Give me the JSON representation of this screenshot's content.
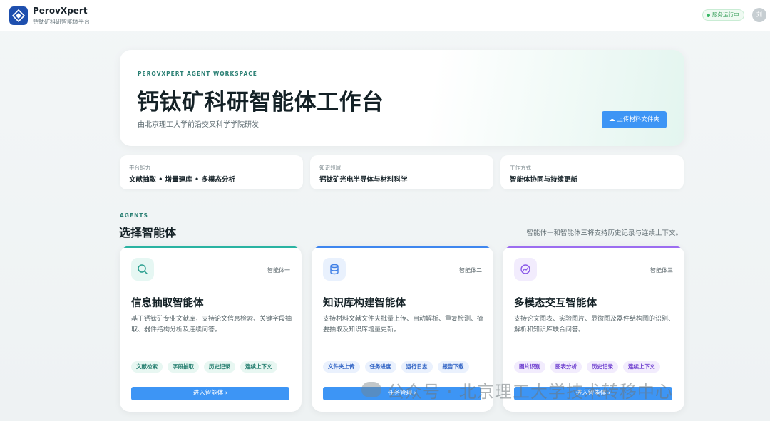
{
  "header": {
    "brand_name": "PerovXpert",
    "brand_sub": "钙钛矿科研智能体平台",
    "status": "服务运行中",
    "avatar_initial": "刘"
  },
  "hero": {
    "eyebrow": "PEROVXPERT AGENT WORKSPACE",
    "title": "钙钛矿科研智能体工作台",
    "subtitle": "由北京理工大学前沿交叉科学学院研发",
    "upload_label": "上传材料文件夹"
  },
  "info_cards": [
    {
      "label": "平台能力",
      "value": "文献抽取 • 增量建库 • 多模态分析"
    },
    {
      "label": "知识领域",
      "value": "钙钛矿光电半导体与材料科学"
    },
    {
      "label": "工作方式",
      "value": "智能体协同与持续更新"
    }
  ],
  "agents_section": {
    "eyebrow": "AGENTS",
    "title": "选择智能体",
    "note": "智能体一和智能体三将支持历史记录与连续上下文。"
  },
  "agents": [
    {
      "index": "智能体一",
      "title": "信息抽取智能体",
      "desc": "基于钙钛矿专业文献库，支持论文信息检索、关键字段抽取、器件结构分析及连续问答。",
      "tags": [
        "文献检索",
        "字段抽取",
        "历史记录",
        "连续上下文"
      ],
      "button": "进入智能体 ›",
      "accent": "#2ab3a2",
      "icon": "search-icon"
    },
    {
      "index": "智能体二",
      "title": "知识库构建智能体",
      "desc": "支持材料文献文件夹批量上传、自动解析、重复检测、摘要抽取及知识库增量更新。",
      "tags": [
        "文件夹上传",
        "任务进度",
        "运行日志",
        "报告下载"
      ],
      "button": "任务管理 ›",
      "accent": "#3f86ef",
      "icon": "database-icon"
    },
    {
      "index": "智能体三",
      "title": "多模态交互智能体",
      "desc": "支持论文图表、实验图片、显微图及器件结构图的识别、解析和知识库联合问答。",
      "tags": [
        "图片识别",
        "图表分析",
        "历史记录",
        "连续上下文"
      ],
      "button": "进入智能体 ›",
      "accent": "#9c6df0",
      "icon": "chart-icon"
    }
  ],
  "watermark": "公众号 · 北京理工大学技术转移中心"
}
